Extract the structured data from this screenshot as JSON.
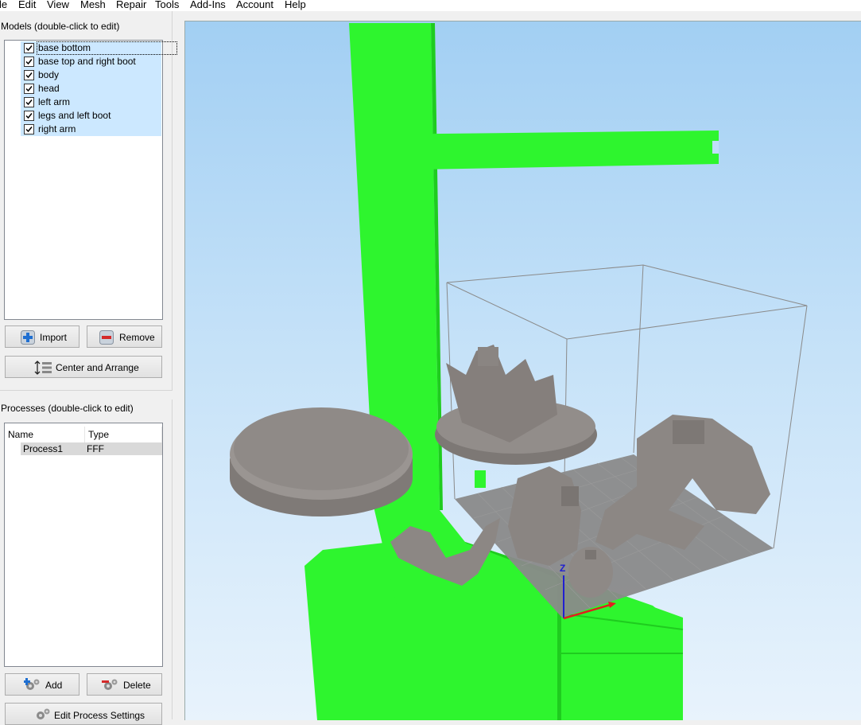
{
  "menubar": {
    "items": [
      "le",
      "Edit",
      "View",
      "Mesh",
      "Repair",
      "Tools",
      "Add-Ins",
      "Account",
      "Help"
    ]
  },
  "models": {
    "label": "Models (double-click to edit)",
    "items": [
      "base bottom",
      "base top and right boot",
      "body",
      "head",
      "left arm",
      "legs and left boot",
      "right arm"
    ],
    "import_label": "Import",
    "remove_label": "Remove",
    "center_arrange_label": "Center and Arrange"
  },
  "processes": {
    "label": "Processes (double-click to edit)",
    "columns": [
      "Name",
      "Type"
    ],
    "rows": [
      {
        "name": "Process1",
        "type": "FFF"
      }
    ],
    "add_label": "Add",
    "delete_label": "Delete",
    "edit_settings_label": "Edit Process Settings"
  },
  "viewport": {
    "axis_label": "Z",
    "colors": {
      "support": "#2ef52e",
      "support_dark": "#1fcc1f",
      "model": "#8e8986",
      "build_plate": "#8a8a8a",
      "sky_top": "#a2cff3",
      "axis_x": "#e02020",
      "axis_z": "#2020d0"
    }
  }
}
